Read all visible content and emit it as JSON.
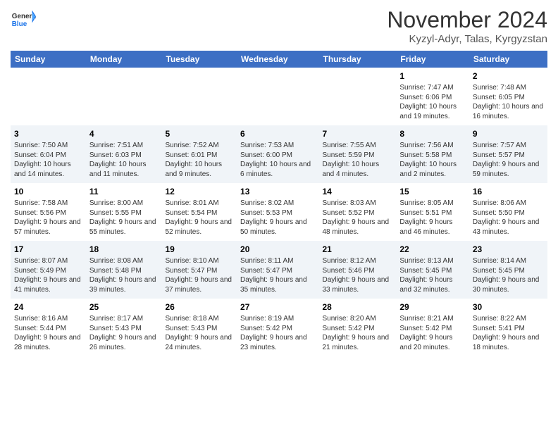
{
  "logo": {
    "general": "General",
    "blue": "Blue"
  },
  "header": {
    "month_title": "November 2024",
    "location": "Kyzyl-Adyr, Talas, Kyrgyzstan"
  },
  "columns": [
    "Sunday",
    "Monday",
    "Tuesday",
    "Wednesday",
    "Thursday",
    "Friday",
    "Saturday"
  ],
  "weeks": [
    {
      "days": [
        {
          "num": "",
          "info": ""
        },
        {
          "num": "",
          "info": ""
        },
        {
          "num": "",
          "info": ""
        },
        {
          "num": "",
          "info": ""
        },
        {
          "num": "",
          "info": ""
        },
        {
          "num": "1",
          "info": "Sunrise: 7:47 AM\nSunset: 6:06 PM\nDaylight: 10 hours and 19 minutes."
        },
        {
          "num": "2",
          "info": "Sunrise: 7:48 AM\nSunset: 6:05 PM\nDaylight: 10 hours and 16 minutes."
        }
      ]
    },
    {
      "days": [
        {
          "num": "3",
          "info": "Sunrise: 7:50 AM\nSunset: 6:04 PM\nDaylight: 10 hours and 14 minutes."
        },
        {
          "num": "4",
          "info": "Sunrise: 7:51 AM\nSunset: 6:03 PM\nDaylight: 10 hours and 11 minutes."
        },
        {
          "num": "5",
          "info": "Sunrise: 7:52 AM\nSunset: 6:01 PM\nDaylight: 10 hours and 9 minutes."
        },
        {
          "num": "6",
          "info": "Sunrise: 7:53 AM\nSunset: 6:00 PM\nDaylight: 10 hours and 6 minutes."
        },
        {
          "num": "7",
          "info": "Sunrise: 7:55 AM\nSunset: 5:59 PM\nDaylight: 10 hours and 4 minutes."
        },
        {
          "num": "8",
          "info": "Sunrise: 7:56 AM\nSunset: 5:58 PM\nDaylight: 10 hours and 2 minutes."
        },
        {
          "num": "9",
          "info": "Sunrise: 7:57 AM\nSunset: 5:57 PM\nDaylight: 9 hours and 59 minutes."
        }
      ]
    },
    {
      "days": [
        {
          "num": "10",
          "info": "Sunrise: 7:58 AM\nSunset: 5:56 PM\nDaylight: 9 hours and 57 minutes."
        },
        {
          "num": "11",
          "info": "Sunrise: 8:00 AM\nSunset: 5:55 PM\nDaylight: 9 hours and 55 minutes."
        },
        {
          "num": "12",
          "info": "Sunrise: 8:01 AM\nSunset: 5:54 PM\nDaylight: 9 hours and 52 minutes."
        },
        {
          "num": "13",
          "info": "Sunrise: 8:02 AM\nSunset: 5:53 PM\nDaylight: 9 hours and 50 minutes."
        },
        {
          "num": "14",
          "info": "Sunrise: 8:03 AM\nSunset: 5:52 PM\nDaylight: 9 hours and 48 minutes."
        },
        {
          "num": "15",
          "info": "Sunrise: 8:05 AM\nSunset: 5:51 PM\nDaylight: 9 hours and 46 minutes."
        },
        {
          "num": "16",
          "info": "Sunrise: 8:06 AM\nSunset: 5:50 PM\nDaylight: 9 hours and 43 minutes."
        }
      ]
    },
    {
      "days": [
        {
          "num": "17",
          "info": "Sunrise: 8:07 AM\nSunset: 5:49 PM\nDaylight: 9 hours and 41 minutes."
        },
        {
          "num": "18",
          "info": "Sunrise: 8:08 AM\nSunset: 5:48 PM\nDaylight: 9 hours and 39 minutes."
        },
        {
          "num": "19",
          "info": "Sunrise: 8:10 AM\nSunset: 5:47 PM\nDaylight: 9 hours and 37 minutes."
        },
        {
          "num": "20",
          "info": "Sunrise: 8:11 AM\nSunset: 5:47 PM\nDaylight: 9 hours and 35 minutes."
        },
        {
          "num": "21",
          "info": "Sunrise: 8:12 AM\nSunset: 5:46 PM\nDaylight: 9 hours and 33 minutes."
        },
        {
          "num": "22",
          "info": "Sunrise: 8:13 AM\nSunset: 5:45 PM\nDaylight: 9 hours and 32 minutes."
        },
        {
          "num": "23",
          "info": "Sunrise: 8:14 AM\nSunset: 5:45 PM\nDaylight: 9 hours and 30 minutes."
        }
      ]
    },
    {
      "days": [
        {
          "num": "24",
          "info": "Sunrise: 8:16 AM\nSunset: 5:44 PM\nDaylight: 9 hours and 28 minutes."
        },
        {
          "num": "25",
          "info": "Sunrise: 8:17 AM\nSunset: 5:43 PM\nDaylight: 9 hours and 26 minutes."
        },
        {
          "num": "26",
          "info": "Sunrise: 8:18 AM\nSunset: 5:43 PM\nDaylight: 9 hours and 24 minutes."
        },
        {
          "num": "27",
          "info": "Sunrise: 8:19 AM\nSunset: 5:42 PM\nDaylight: 9 hours and 23 minutes."
        },
        {
          "num": "28",
          "info": "Sunrise: 8:20 AM\nSunset: 5:42 PM\nDaylight: 9 hours and 21 minutes."
        },
        {
          "num": "29",
          "info": "Sunrise: 8:21 AM\nSunset: 5:42 PM\nDaylight: 9 hours and 20 minutes."
        },
        {
          "num": "30",
          "info": "Sunrise: 8:22 AM\nSunset: 5:41 PM\nDaylight: 9 hours and 18 minutes."
        }
      ]
    }
  ]
}
